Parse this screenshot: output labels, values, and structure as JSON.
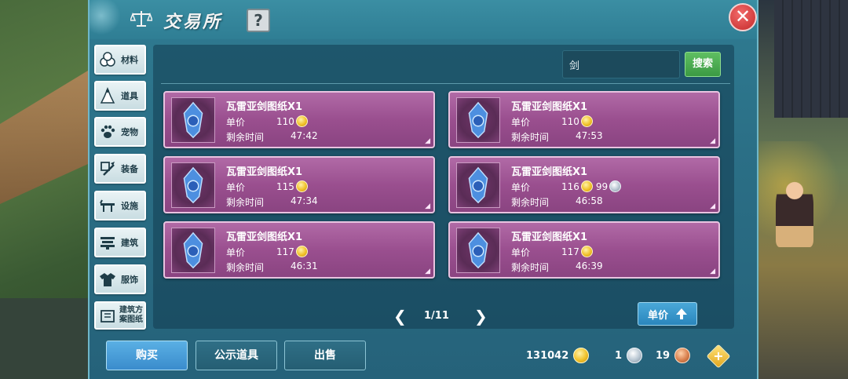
{
  "window": {
    "title": "交易所",
    "help_label": "?",
    "close_label": "✕"
  },
  "sidebar": {
    "items": [
      {
        "label": "材料",
        "icon": "materials-icon"
      },
      {
        "label": "道具",
        "icon": "props-icon"
      },
      {
        "label": "宠物",
        "icon": "paw-icon"
      },
      {
        "label": "装备",
        "icon": "equipment-icon"
      },
      {
        "label": "设施",
        "icon": "facility-icon"
      },
      {
        "label": "建筑",
        "icon": "building-icon"
      },
      {
        "label": "服饰",
        "icon": "clothing-icon"
      },
      {
        "label": "建筑方案图纸",
        "icon": "blueprint-icon"
      }
    ]
  },
  "search": {
    "value": "剑",
    "button_label": "搜索"
  },
  "listings": [
    {
      "name": "瓦雷亚剑图纸X1",
      "price_label": "单价",
      "gold": "110",
      "silver": "",
      "time_label": "剩余时间",
      "time": "47:42"
    },
    {
      "name": "瓦雷亚剑图纸X1",
      "price_label": "单价",
      "gold": "110",
      "silver": "",
      "time_label": "剩余时间",
      "time": "47:53"
    },
    {
      "name": "瓦雷亚剑图纸X1",
      "price_label": "单价",
      "gold": "115",
      "silver": "",
      "time_label": "剩余时间",
      "time": "47:34"
    },
    {
      "name": "瓦雷亚剑图纸X1",
      "price_label": "单价",
      "gold": "116",
      "silver": "99",
      "time_label": "剩余时间",
      "time": "46:58"
    },
    {
      "name": "瓦雷亚剑图纸X1",
      "price_label": "单价",
      "gold": "117",
      "silver": "",
      "time_label": "剩余时间",
      "time": "46:31"
    },
    {
      "name": "瓦雷亚剑图纸X1",
      "price_label": "单价",
      "gold": "117",
      "silver": "",
      "time_label": "剩余时间",
      "time": "46:39"
    }
  ],
  "pagination": {
    "prev": "❮",
    "text": "1/11",
    "next": "❯"
  },
  "sort": {
    "label": "单价"
  },
  "bottom": {
    "buy_label": "购买",
    "notice_label": "公示道具",
    "sell_label": "出售",
    "add_label": "+"
  },
  "wallet": {
    "gold": "131042",
    "silver": "1",
    "copper": "19"
  },
  "colors": {
    "panel": "#2b6f86",
    "card": "#9a4f8f",
    "buy_button": "#3a8ccc",
    "search_button": "#3b9a44",
    "close_button": "#c42a2a",
    "gold_coin": "#f1c22a"
  }
}
